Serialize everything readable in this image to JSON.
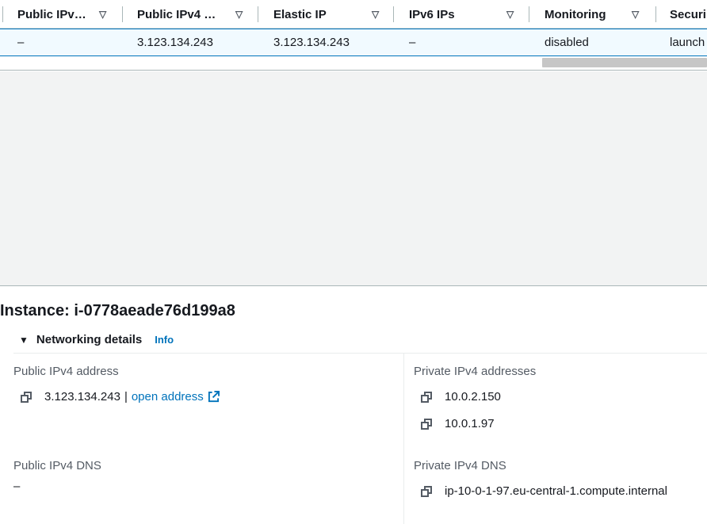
{
  "table": {
    "columns": [
      {
        "label": "Public IPv…"
      },
      {
        "label": "Public IPv4 …"
      },
      {
        "label": "Elastic IP"
      },
      {
        "label": "IPv6 IPs"
      },
      {
        "label": "Monitoring"
      },
      {
        "label": "Securi"
      }
    ],
    "row": {
      "cells": [
        "–",
        "3.123.134.243",
        "3.123.134.243",
        "–",
        "disabled",
        "launch"
      ]
    }
  },
  "details": {
    "instance_title": "Instance: i-0778aeade76d199a8",
    "section_title": "Networking details",
    "info_label": "Info",
    "public_ipv4_address": {
      "label": "Public IPv4 address",
      "value": "3.123.134.243",
      "separator": "|",
      "link_label": "open address"
    },
    "private_ipv4_addresses": {
      "label": "Private IPv4 addresses",
      "values": [
        "10.0.2.150",
        "10.0.1.97"
      ]
    },
    "public_ipv4_dns": {
      "label": "Public IPv4 DNS",
      "value": "–"
    },
    "private_ipv4_dns": {
      "label": "Private IPv4 DNS",
      "value": "ip-10-0-1-97.eu-central-1.compute.internal"
    }
  },
  "colors": {
    "link": "#0073bb",
    "selected_row_bg": "#f1faff",
    "selected_row_border": "#0073bb",
    "empty_area_bg": "#f2f3f3"
  },
  "icons": {
    "sort": "caret-down-outline-icon",
    "copy": "copy-icon",
    "external": "external-link-icon",
    "expand": "caret-down-filled-icon",
    "resize": "drag-handle-icon"
  }
}
